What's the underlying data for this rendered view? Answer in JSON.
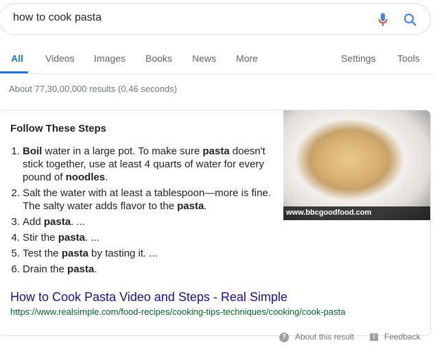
{
  "search": {
    "query": "how to cook pasta"
  },
  "tabs": [
    {
      "label": "All"
    },
    {
      "label": "Videos"
    },
    {
      "label": "Images"
    },
    {
      "label": "Books"
    },
    {
      "label": "News"
    },
    {
      "label": "More"
    },
    {
      "label": "Settings"
    },
    {
      "label": "Tools"
    }
  ],
  "stats": "About 77,30,00,000 results (0.46 seconds)",
  "snippet": {
    "heading": "Follow These Steps",
    "image_caption": "www.bbcgoodfood.com",
    "steps": [
      [
        {
          "t": "Boil",
          "b": true
        },
        {
          "t": " water in a large pot. To make sure "
        },
        {
          "t": "pasta",
          "b": true
        },
        {
          "t": " doesn't stick together, use at least 4 quarts of water for every pound of "
        },
        {
          "t": "noodles",
          "b": true
        },
        {
          "t": "."
        }
      ],
      [
        {
          "t": "Salt the water with at least a tablespoon—more is fine. The salty water adds flavor to the "
        },
        {
          "t": "pasta",
          "b": true
        },
        {
          "t": "."
        }
      ],
      [
        {
          "t": "Add "
        },
        {
          "t": "pasta",
          "b": true
        },
        {
          "t": ". ..."
        }
      ],
      [
        {
          "t": "Stir the "
        },
        {
          "t": "pasta",
          "b": true
        },
        {
          "t": ". ..."
        }
      ],
      [
        {
          "t": "Test the "
        },
        {
          "t": "pasta",
          "b": true
        },
        {
          "t": " by tasting it. ..."
        }
      ],
      [
        {
          "t": "Drain the "
        },
        {
          "t": "pasta",
          "b": true
        },
        {
          "t": "."
        }
      ]
    ],
    "result_title": "How to Cook Pasta Video and Steps - Real Simple",
    "result_url": "https://www.realsimple.com/food-recipes/cooking-tips-techniques/cooking/cook-pasta"
  },
  "footer": {
    "about": "About this result",
    "feedback": "Feedback",
    "about_icon": "?",
    "feedback_icon": "!"
  },
  "colors": {
    "accent": "#1a73e8",
    "link": "#1a0dab",
    "url": "#006621"
  }
}
